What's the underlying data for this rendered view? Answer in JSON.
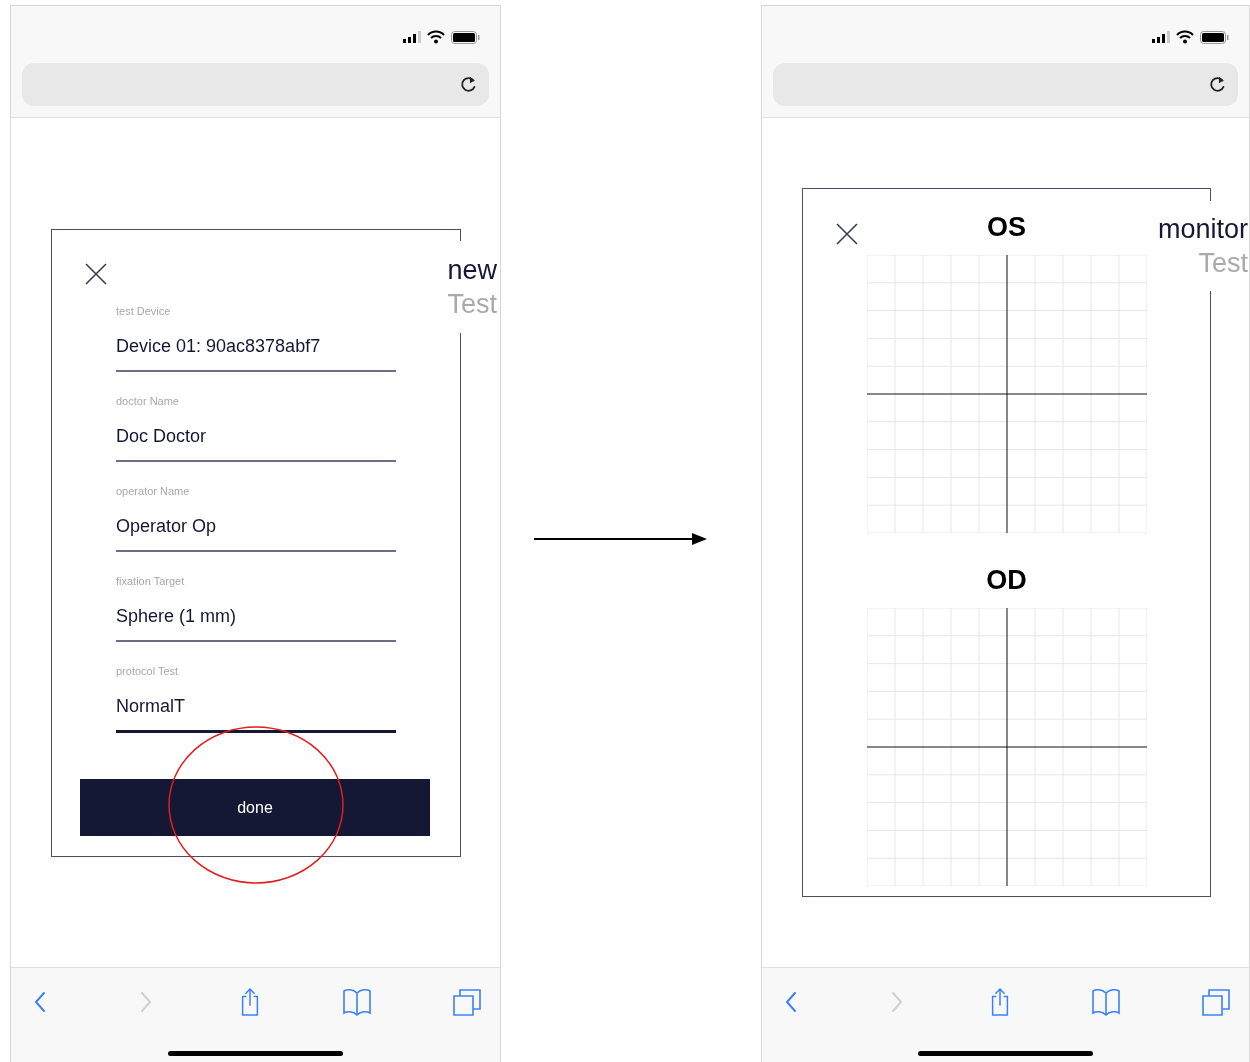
{
  "screens": [
    {
      "kind": "form",
      "title": "new",
      "subtitle": "Test",
      "fields": [
        {
          "label": "test Device",
          "value": "Device 01: 90ac8378abf7",
          "focused": false
        },
        {
          "label": "doctor Name",
          "value": "Doc Doctor",
          "focused": false
        },
        {
          "label": "operator Name",
          "value": "Operator Op",
          "focused": false
        },
        {
          "label": "fixation Target",
          "value": "Sphere (1 mm)",
          "focused": false
        },
        {
          "label": "protocol Test",
          "value": "NormalT",
          "focused": true
        }
      ],
      "button": "done",
      "toolbar": [
        {
          "kind": "back",
          "disabled": false
        },
        {
          "kind": "forward",
          "disabled": true
        },
        {
          "kind": "share",
          "disabled": false
        },
        {
          "kind": "bookmarks",
          "disabled": false
        },
        {
          "kind": "tabs",
          "disabled": false
        }
      ]
    },
    {
      "kind": "monitor",
      "title": "monitor",
      "subtitle": "Test",
      "charts": [
        {
          "label": "OS"
        },
        {
          "label": "OD"
        }
      ],
      "toolbar": [
        {
          "kind": "back",
          "disabled": false
        },
        {
          "kind": "forward",
          "disabled": true
        },
        {
          "kind": "share",
          "disabled": false
        },
        {
          "kind": "bookmarks",
          "disabled": false
        },
        {
          "kind": "tabs",
          "disabled": false
        }
      ]
    }
  ]
}
